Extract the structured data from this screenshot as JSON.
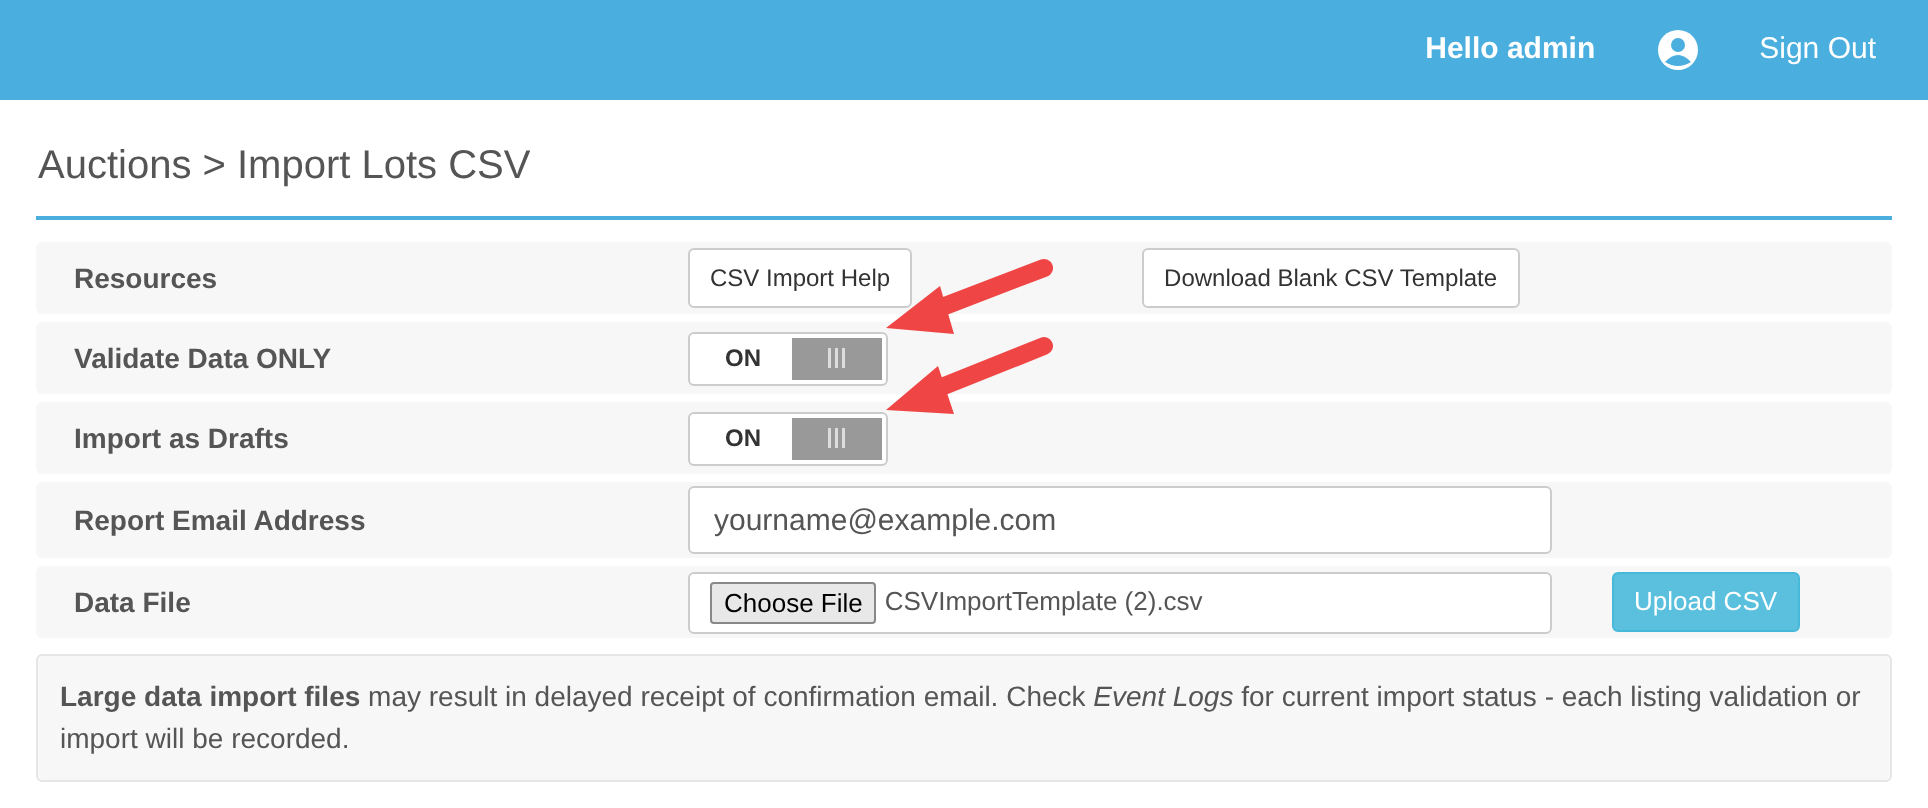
{
  "header": {
    "greeting": "Hello admin",
    "sign_out": "Sign Out"
  },
  "page_title": "Auctions > Import Lots CSV",
  "rows": [
    {
      "kind": "buttons",
      "label": "Resources",
      "buttons": [
        "CSV Import Help",
        "Download Blank CSV Template"
      ]
    },
    {
      "kind": "toggle",
      "label": "Validate Data ONLY",
      "toggle_label": "ON",
      "on": true
    },
    {
      "kind": "toggle",
      "label": "Import as Drafts",
      "toggle_label": "ON",
      "on": true
    },
    {
      "kind": "input",
      "label": "Report Email Address",
      "placeholder": "yourname@example.com"
    },
    {
      "kind": "file",
      "label": "Data File",
      "choose_button": "Choose File",
      "file_name": "CSVImportTemplate (2).csv",
      "upload_button": "Upload CSV"
    }
  ],
  "note": "**Large data import files** may result in delayed receipt of confirmation email. Check *Event Logs* for current import status - each listing validation or import will be recorded."
}
